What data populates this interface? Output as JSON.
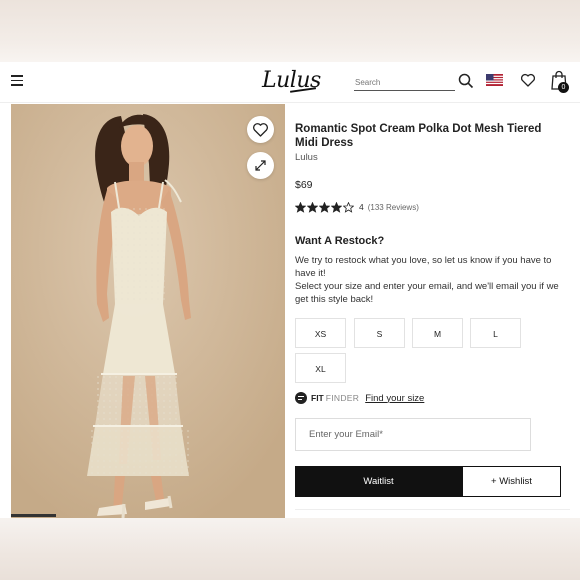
{
  "header": {
    "logo_text": "Lulus",
    "search_placeholder": "Search",
    "cart_count": "0"
  },
  "product": {
    "title": "Romantic Spot Cream Polka Dot Mesh Tiered Midi Dress",
    "brand": "Lulus",
    "price": "$69",
    "rating_value": "4",
    "rating_stars": 4,
    "rating_max": 5,
    "review_count_label": "(133 Reviews)"
  },
  "restock": {
    "title": "Want A Restock?",
    "line1": "We try to restock what you love, so let us know if you have to have it!",
    "line2": "Select your size and enter your email, and we'll email you if we get this style back!"
  },
  "sizes": [
    "XS",
    "S",
    "M",
    "L",
    "XL"
  ],
  "fit_finder": {
    "fit": "FIT",
    "finder": "FINDER",
    "link": "Find your size"
  },
  "email": {
    "placeholder": "Enter your Email*"
  },
  "actions": {
    "waitlist": "Waitlist",
    "wishlist": "+ Wishlist"
  },
  "colors": {
    "accent": "#111111",
    "star": "#222222",
    "image_bg": "#d2ba9d"
  }
}
